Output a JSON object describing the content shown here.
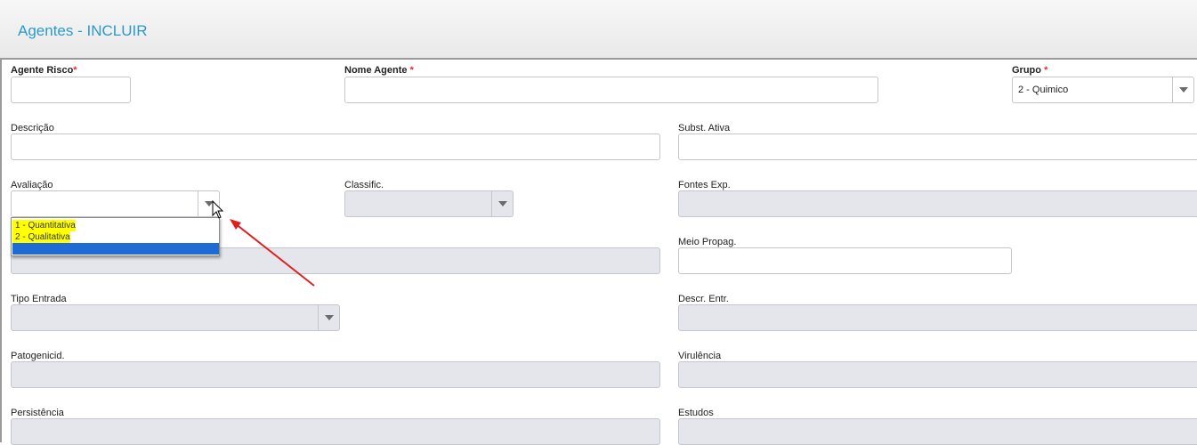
{
  "header": {
    "title": "Agentes - INCLUIR"
  },
  "form": {
    "agente_risco": {
      "label": "Agente Risco",
      "required": "*",
      "value": ""
    },
    "nome_agente": {
      "label": "Nome Agente",
      "required": "*",
      "value": ""
    },
    "grupo": {
      "label": "Grupo",
      "required": "*",
      "value": "2 - Quimico"
    },
    "descricao": {
      "label": "Descrição",
      "value": ""
    },
    "subst_ativa": {
      "label": "Subst. Ativa",
      "value": ""
    },
    "avaliacao": {
      "label": "Avaliação",
      "value": "",
      "options": [
        "1 - Quantitativa",
        "2 - Qualitativa",
        ""
      ],
      "highlight_color": "#ffff00",
      "selected_color": "#1e6bd6"
    },
    "classific": {
      "label": "Classific.",
      "value": ""
    },
    "fontes_exp": {
      "label": "Fontes Exp.",
      "value": ""
    },
    "meio_propag": {
      "label": "Meio Propag.",
      "value": ""
    },
    "tipo_entrada": {
      "label": "Tipo Entrada",
      "value": ""
    },
    "descr_entr": {
      "label": "Descr. Entr.",
      "value": ""
    },
    "patogenicid": {
      "label": "Patogenicid.",
      "value": ""
    },
    "virulencia": {
      "label": "Virulência",
      "value": ""
    },
    "persistencia": {
      "label": "Persistência",
      "value": ""
    },
    "estudos": {
      "label": "Estudos",
      "value": ""
    }
  },
  "colors": {
    "title": "#2a9bc9",
    "required": "#e03030",
    "disabled_field": "#e4e6ec",
    "annotation_arrow": "#e02020"
  },
  "icons": {
    "select_arrow": "chevron-down-icon",
    "cursor": "mouse-pointer-icon",
    "annotation": "red-arrow-icon"
  }
}
